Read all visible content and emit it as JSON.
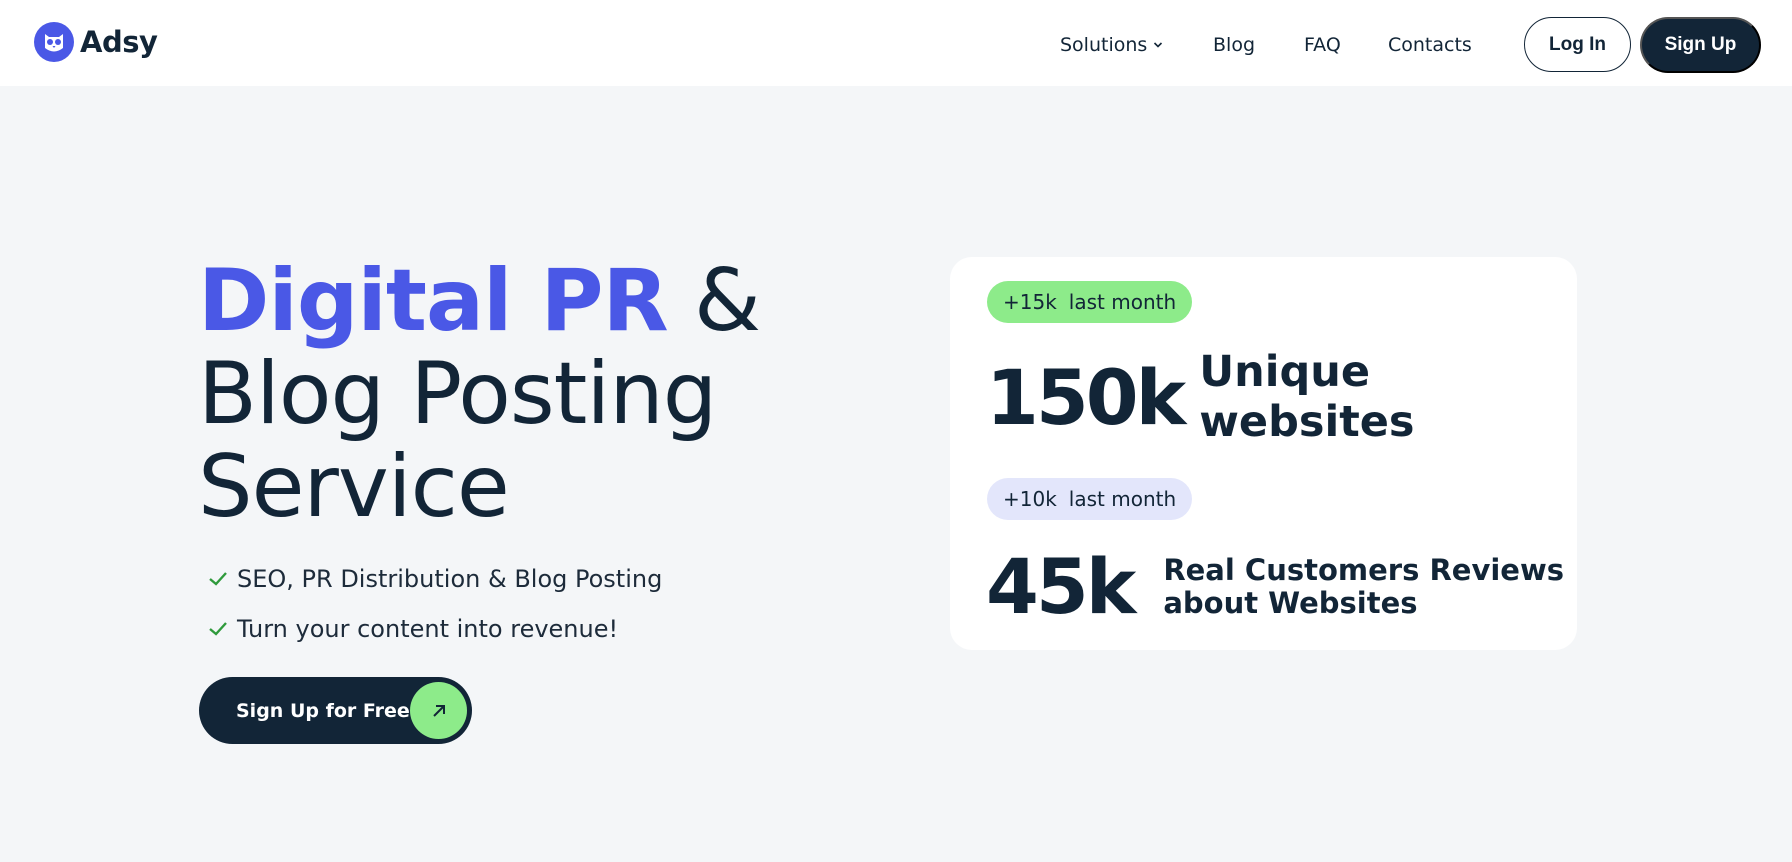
{
  "header": {
    "logo_text": "Adsy",
    "logo_icon": "owl-logo-icon",
    "nav": {
      "solutions": "Solutions",
      "blog": "Blog",
      "faq": "FAQ",
      "contacts": "Contacts"
    },
    "login_label": "Log In",
    "signup_label": "Sign Up"
  },
  "hero": {
    "title_accent": "Digital PR",
    "title_rest_line1": " &",
    "title_line2": "Blog Posting",
    "title_line3": "Service",
    "bullets": [
      "SEO, PR Distribution & Blog Posting",
      "Turn your content into revenue!"
    ],
    "cta_label": "Sign Up for Free"
  },
  "stats": {
    "items": [
      {
        "badge_delta": "+15k",
        "badge_period": "last month",
        "number": "150k",
        "label": "Unique websites",
        "badge_color": "#8deb8a"
      },
      {
        "badge_delta": "+10k",
        "badge_period": "last month",
        "number": "45k",
        "label_line1": "Real Customers Reviews",
        "label_line2": "about Websites",
        "badge_color": "#e3e6fb"
      }
    ]
  },
  "colors": {
    "accent": "#4a58e6",
    "dark": "#122537",
    "green": "#8deb8a",
    "background": "#f4f6f8"
  }
}
